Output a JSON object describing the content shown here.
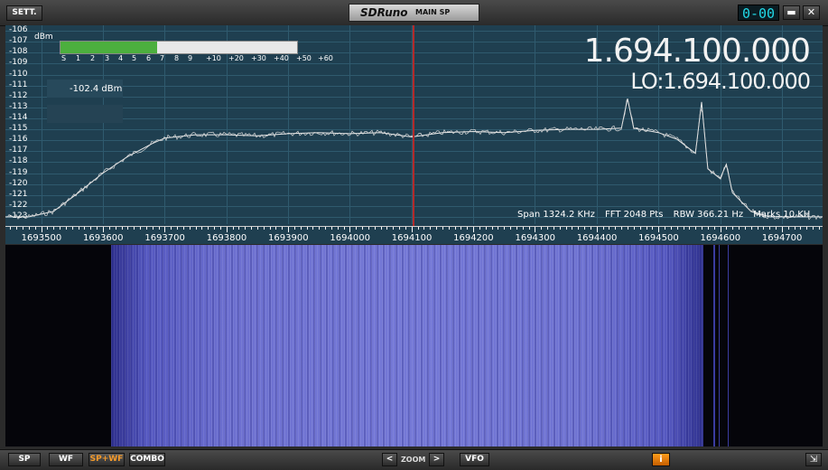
{
  "titlebar": {
    "settings_label": "SETT.",
    "brand": "SDRuno",
    "mode": "MAIN SP",
    "clock": "0-00",
    "minimize_icon": "minimize-icon",
    "close_icon": "close-icon"
  },
  "meter": {
    "unit": "dBm",
    "scale": [
      "S",
      "1",
      "2",
      "3",
      "4",
      "5",
      "6",
      "7",
      "8",
      "9",
      "+10",
      "+20",
      "+30",
      "+40",
      "+50",
      "+60"
    ],
    "level_fraction": 0.41,
    "rssi": "-102.4 dBm"
  },
  "freq": {
    "main": "1.694.100.000",
    "lo": "LO:1.694.100.000"
  },
  "info": {
    "span": "Span 1324.2 KHz",
    "fft": "FFT 2048 Pts",
    "rbw": "RBW 366.21 Hz",
    "marks": "Marks 10 KH"
  },
  "chart_data": {
    "type": "line",
    "xlabel": "",
    "ylabel": "dBm",
    "x_ticks": [
      "1693500",
      "1693600",
      "1693700",
      "1693800",
      "1693900",
      "1694000",
      "1694100",
      "1694200",
      "1694300",
      "1694400",
      "1694500",
      "1694600",
      "1694700"
    ],
    "y_ticks": [
      "-106",
      "-107",
      "-108",
      "-109",
      "-110",
      "-111",
      "-112",
      "-113",
      "-114",
      "-115",
      "-116",
      "-117",
      "-118",
      "-119",
      "-120",
      "-121",
      "-122",
      "-123"
    ],
    "xlim": [
      1693442,
      1694766
    ],
    "ylim": [
      -123.5,
      -105.5
    ],
    "tuned_freq": 1694100,
    "series": [
      {
        "x": [
          1693442,
          1693480,
          1693520,
          1693560,
          1693600,
          1693640,
          1693680,
          1693700,
          1693750,
          1693800,
          1693850,
          1693900,
          1693950,
          1694000,
          1694050,
          1694100,
          1694150,
          1694200,
          1694250,
          1694300,
          1694350,
          1694400,
          1694440,
          1694450,
          1694460,
          1694500,
          1694530,
          1694560,
          1694570,
          1694580,
          1694600,
          1694610,
          1694620,
          1694650,
          1694680,
          1694700,
          1694766
        ],
        "y": [
          -123,
          -123,
          -122.5,
          -120.8,
          -119,
          -117.5,
          -116.3,
          -115.8,
          -115.5,
          -115.5,
          -115.6,
          -115.4,
          -115.3,
          -115.4,
          -115.3,
          -115.7,
          -115.3,
          -115.2,
          -115.3,
          -115.1,
          -115.0,
          -115.0,
          -114.9,
          -112.2,
          -114.9,
          -115.3,
          -115.9,
          -117.2,
          -112.5,
          -118.6,
          -119.5,
          -118.2,
          -120.8,
          -122.5,
          -123,
          -123,
          -123
        ]
      }
    ]
  },
  "bottombar": {
    "sp": "SP",
    "wf": "WF",
    "spwf": "SP+WF",
    "combo": "COMBO",
    "zoom_out": "<",
    "zoom": "ZOOM",
    "zoom_in": ">",
    "vfo": "VFO",
    "info": "i",
    "resize_icon": "resize-icon"
  }
}
